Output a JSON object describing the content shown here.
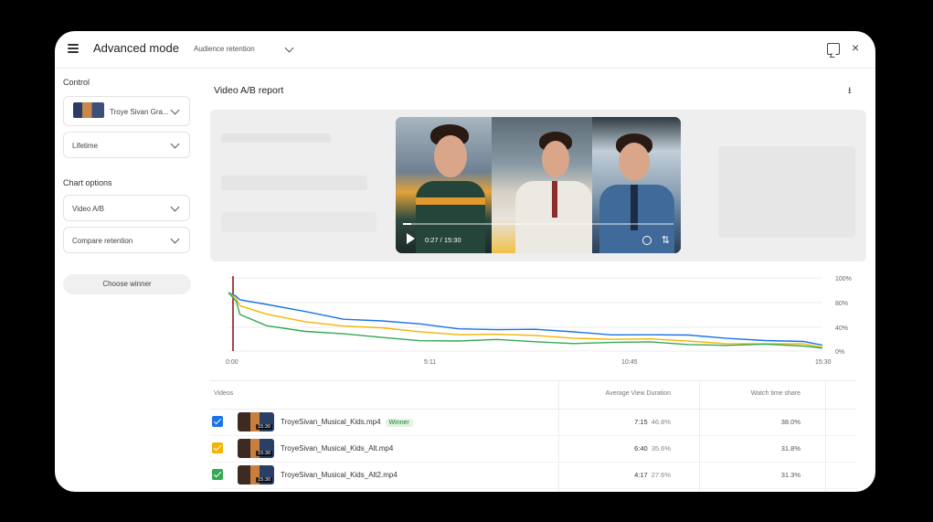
{
  "header": {
    "title": "Advanced mode",
    "audience": "Audience retention"
  },
  "sidebar": {
    "control_label": "Control",
    "video_select": "Troye Sivan Gra...",
    "period_select": "Lifetime",
    "chart_options_label": "Chart options",
    "chart_type_select": "Video A/B",
    "compare_select": "Compare retention",
    "choose_winner": "Choose winner"
  },
  "main": {
    "report_title": "Video A/B report",
    "player": {
      "time": "0:27 / 15:30"
    }
  },
  "chart_data": {
    "type": "line",
    "x_ticks": [
      "0:00",
      "5:11",
      "10:45",
      "15:30"
    ],
    "y_ticks": [
      "100%",
      "80%",
      "40%",
      "0%"
    ],
    "ylim": [
      0,
      100
    ],
    "grid": true,
    "x": [
      0,
      0.2,
      0.3,
      1,
      2,
      3,
      4,
      5,
      6,
      7,
      8,
      9,
      10,
      11,
      12,
      13,
      14,
      15,
      15.5
    ],
    "series": [
      {
        "color": "#1a73e8",
        "values": [
          80,
          75,
          70,
          62,
          55,
          45,
          40,
          36,
          32,
          30,
          28,
          26,
          24,
          22,
          20,
          18,
          16,
          12,
          8
        ]
      },
      {
        "color": "#f4b400",
        "values": [
          80,
          72,
          62,
          50,
          42,
          34,
          30,
          27,
          24,
          22,
          20,
          19,
          17,
          15,
          13,
          12,
          10,
          8,
          5
        ]
      },
      {
        "color": "#34a853",
        "values": [
          80,
          68,
          50,
          36,
          28,
          22,
          18,
          16,
          14,
          14,
          13,
          12,
          11,
          11,
          10,
          9,
          8,
          6,
          4
        ]
      }
    ]
  },
  "table": {
    "headers": {
      "video": "Videos",
      "avd": "Average View Duration",
      "watch": "Watch time share"
    },
    "rows": [
      {
        "name": "TroyeSivan_Musical_Kids.mp4",
        "badge": "Winner",
        "duration": "15:30",
        "avd": "7:15",
        "avd_pct": "46.8%",
        "watch": "38.0%",
        "color": "#1a73e8"
      },
      {
        "name": "TroyeSivan_Musical_Kids_Alt.mp4",
        "badge": "",
        "duration": "15:30",
        "avd": "6:40",
        "avd_pct": "35.6%",
        "watch": "31.8%",
        "color": "#f4b400"
      },
      {
        "name": "TroyeSivan_Musical_Kids_Alt2.mp4",
        "badge": "",
        "duration": "15:30",
        "avd": "4:17",
        "avd_pct": "27.6%",
        "watch": "31.3%",
        "color": "#34a853"
      }
    ]
  }
}
